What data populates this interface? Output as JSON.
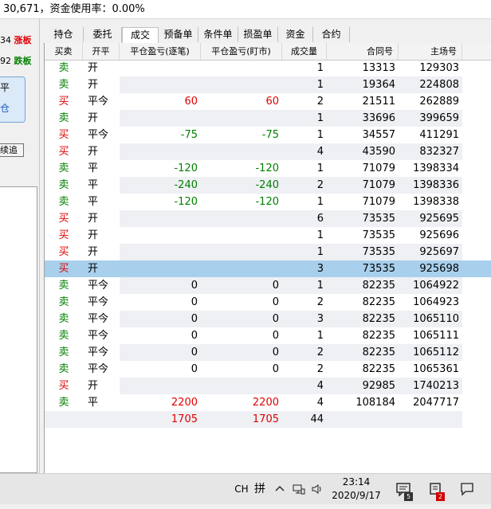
{
  "topbar": {
    "text": "30,671，资金使用率：0.00%"
  },
  "left_panel": {
    "row1_num": "34",
    "row1_label": "涨板",
    "row2_num": "92",
    "row2_label": "跌板",
    "box_text1": "平",
    "box_text2": "仓",
    "button_label": "续追"
  },
  "tabs": [
    "持仓",
    "委托",
    "成交",
    "预备单",
    "条件单",
    "损盈单",
    "资金",
    "合约"
  ],
  "active_tab": "成交",
  "columns": {
    "dir": "买卖",
    "oc": "开平",
    "profit1": "平仓盈亏(逐笔)",
    "profit2": "平仓盈亏(盯市)",
    "qty": "成交量",
    "contract": "合同号",
    "main": "主场号"
  },
  "rows": [
    {
      "dir": "卖",
      "oc": "开",
      "p1": "",
      "p2": "",
      "qty": "1",
      "contract": "13313",
      "main": "129303"
    },
    {
      "dir": "卖",
      "oc": "开",
      "p1": "",
      "p2": "",
      "qty": "1",
      "contract": "19364",
      "main": "224808"
    },
    {
      "dir": "买",
      "oc": "平今",
      "p1": "60",
      "p2": "60",
      "qty": "2",
      "contract": "21511",
      "main": "262889"
    },
    {
      "dir": "卖",
      "oc": "开",
      "p1": "",
      "p2": "",
      "qty": "1",
      "contract": "33696",
      "main": "399659"
    },
    {
      "dir": "买",
      "oc": "平今",
      "p1": "-75",
      "p2": "-75",
      "qty": "1",
      "contract": "34557",
      "main": "411291"
    },
    {
      "dir": "买",
      "oc": "开",
      "p1": "",
      "p2": "",
      "qty": "4",
      "contract": "43590",
      "main": "832327"
    },
    {
      "dir": "卖",
      "oc": "平",
      "p1": "-120",
      "p2": "-120",
      "qty": "1",
      "contract": "71079",
      "main": "1398334"
    },
    {
      "dir": "卖",
      "oc": "平",
      "p1": "-240",
      "p2": "-240",
      "qty": "2",
      "contract": "71079",
      "main": "1398336"
    },
    {
      "dir": "卖",
      "oc": "平",
      "p1": "-120",
      "p2": "-120",
      "qty": "1",
      "contract": "71079",
      "main": "1398338"
    },
    {
      "dir": "买",
      "oc": "开",
      "p1": "",
      "p2": "",
      "qty": "6",
      "contract": "73535",
      "main": "925695"
    },
    {
      "dir": "买",
      "oc": "开",
      "p1": "",
      "p2": "",
      "qty": "1",
      "contract": "73535",
      "main": "925696"
    },
    {
      "dir": "买",
      "oc": "开",
      "p1": "",
      "p2": "",
      "qty": "1",
      "contract": "73535",
      "main": "925697"
    },
    {
      "dir": "买",
      "oc": "开",
      "p1": "",
      "p2": "",
      "qty": "3",
      "contract": "73535",
      "main": "925698"
    },
    {
      "dir": "卖",
      "oc": "平今",
      "p1": "0",
      "p2": "0",
      "qty": "1",
      "contract": "82235",
      "main": "1064922"
    },
    {
      "dir": "卖",
      "oc": "平今",
      "p1": "0",
      "p2": "0",
      "qty": "2",
      "contract": "82235",
      "main": "1064923"
    },
    {
      "dir": "卖",
      "oc": "平今",
      "p1": "0",
      "p2": "0",
      "qty": "3",
      "contract": "82235",
      "main": "1065110"
    },
    {
      "dir": "卖",
      "oc": "平今",
      "p1": "0",
      "p2": "0",
      "qty": "1",
      "contract": "82235",
      "main": "1065111"
    },
    {
      "dir": "卖",
      "oc": "平今",
      "p1": "0",
      "p2": "0",
      "qty": "2",
      "contract": "82235",
      "main": "1065112"
    },
    {
      "dir": "卖",
      "oc": "平今",
      "p1": "0",
      "p2": "0",
      "qty": "2",
      "contract": "82235",
      "main": "1065361"
    },
    {
      "dir": "买",
      "oc": "开",
      "p1": "",
      "p2": "",
      "qty": "4",
      "contract": "92985",
      "main": "1740213"
    },
    {
      "dir": "卖",
      "oc": "平",
      "p1": "2200",
      "p2": "2200",
      "qty": "4",
      "contract": "108184",
      "main": "2047717"
    }
  ],
  "selected_row_index": 12,
  "totals": {
    "p1": "1705",
    "p2": "1705",
    "qty": "44"
  },
  "taskbar": {
    "ime": "CH",
    "ime_mode": "拼",
    "time": "23:14",
    "date": "2020/9/17",
    "badge1": "5",
    "badge2": "2"
  },
  "colors": {
    "buy": "#e00000",
    "sell": "#008000",
    "selected": "#a8d0ec"
  }
}
